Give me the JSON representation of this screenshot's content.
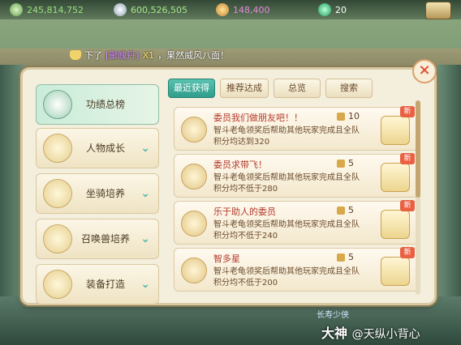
{
  "resources": {
    "silver": "245,814,752",
    "coins": "600,526,505",
    "gems": "148,400",
    "jade": "20"
  },
  "broadcast": {
    "prefix": "下了",
    "item": "[聚魄丹]",
    "qty": "X1",
    "suffix": "，果然威风八面！"
  },
  "sidebar": [
    {
      "label": "功绩总榜",
      "active": true
    },
    {
      "label": "人物成长"
    },
    {
      "label": "坐骑培养"
    },
    {
      "label": "召唤兽培养"
    },
    {
      "label": "装备打造"
    }
  ],
  "tabs": [
    {
      "label": "最近获得",
      "active": true
    },
    {
      "label": "推荐达成"
    },
    {
      "label": "总览"
    },
    {
      "label": "搜索"
    }
  ],
  "cards": [
    {
      "title": "委员我们做朋友吧！！",
      "desc1": "智斗老龟领奖后帮助其他玩家完成且全队",
      "desc2": "积分均达到320",
      "points": "10",
      "new": "新"
    },
    {
      "title": "委员求带飞！",
      "desc1": "智斗老龟领奖后帮助其他玩家完成且全队",
      "desc2": "积分均不低于280",
      "points": "5",
      "new": "新"
    },
    {
      "title": "乐于助人的委员",
      "desc1": "智斗老龟领奖后帮助其他玩家完成且全队",
      "desc2": "积分均不低于240",
      "points": "5",
      "new": "新"
    },
    {
      "title": "智多星",
      "desc1": "智斗老龟领奖后帮助其他玩家完成且全队",
      "desc2": "积分均不低于200",
      "points": "5",
      "new": "新"
    }
  ],
  "close_label": "×",
  "footer": {
    "label": "长寿少侠",
    "watermark_main": "大神",
    "watermark_sub": "@天纵小背心"
  }
}
